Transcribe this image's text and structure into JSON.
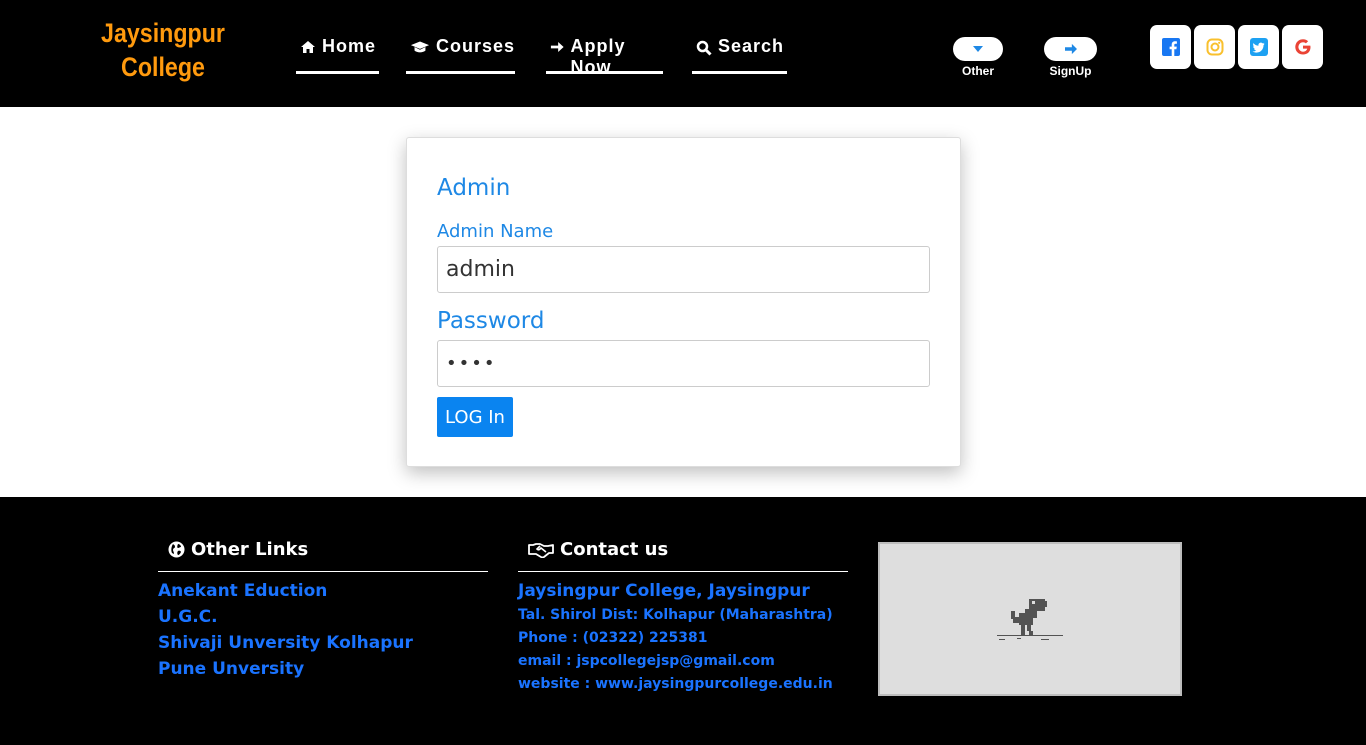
{
  "header": {
    "brand_line1": "Jaysingpur",
    "brand_line2": "College",
    "nav": {
      "home": "Home",
      "courses": "Courses",
      "apply": "Apply Now",
      "search": "Search"
    },
    "other_label": "Other",
    "signup_label": "SignUp",
    "social": [
      "facebook-icon",
      "instagram-icon",
      "twitter-icon",
      "google-icon"
    ]
  },
  "login": {
    "title": "Admin",
    "name_label": "Admin Name",
    "name_value": "admin",
    "password_label": "Password",
    "password_value": "••••",
    "button": "LOG In"
  },
  "footer": {
    "links_heading": "Other Links",
    "links": [
      "Anekant Eduction",
      "U.G.C.",
      "Shivaji Unversity Kolhapur",
      "Pune Unversity"
    ],
    "contact_heading": "Contact us",
    "contact": {
      "name": "Jaysingpur College, Jaysingpur",
      "address": "Tal. Shirol Dist: Kolhapur (Maharashtra)",
      "phone": "Phone : (02322) 225381",
      "email": "email : jspcollegejsp@gmail.com",
      "website": "website : www.jaysingpurcollege.edu.in"
    }
  },
  "colors": {
    "brand": "#ff9a0e",
    "accent_blue": "#1e88e5",
    "button_blue": "#0a84f0",
    "link_blue": "#1a73ff"
  }
}
